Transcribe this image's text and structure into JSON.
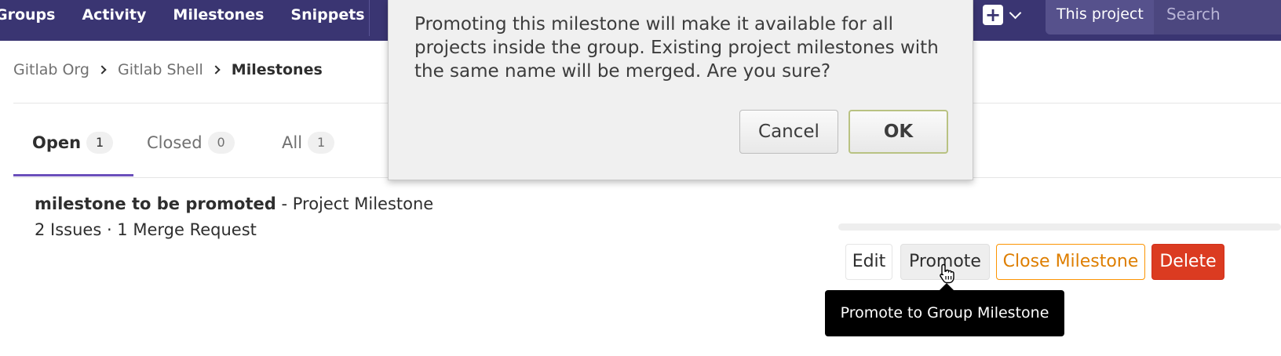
{
  "navbar": {
    "links": [
      "Groups",
      "Activity",
      "Milestones",
      "Snippets"
    ],
    "new_icon": "plus-square-icon",
    "search_scope": "This project",
    "search_placeholder": "Search"
  },
  "breadcrumb": {
    "items": [
      "Gitlab Org",
      "Gitlab Shell"
    ],
    "current": "Milestones"
  },
  "tabs": [
    {
      "label": "Open",
      "count": "1",
      "active": true
    },
    {
      "label": "Closed",
      "count": "0",
      "active": false
    },
    {
      "label": "All",
      "count": "1",
      "active": false
    }
  ],
  "milestone": {
    "title": "milestone to be promoted",
    "type_suffix": "- Project Milestone",
    "meta": "2 Issues · 1 Merge Request",
    "actions": {
      "edit": "Edit",
      "promote": "Promote",
      "close": "Close Milestone",
      "delete": "Delete"
    }
  },
  "tooltip": "Promote to Group Milestone",
  "dialog": {
    "message": "Promoting this milestone will make it available for all projects inside the group. Existing project milestones with the same name will be merged. Are you sure?",
    "cancel": "Cancel",
    "ok": "OK"
  },
  "colors": {
    "navbar": "#3a3572",
    "active_tab_underline": "#6b4fbb",
    "close_button": "#fc9403",
    "delete_button": "#db3b21"
  }
}
